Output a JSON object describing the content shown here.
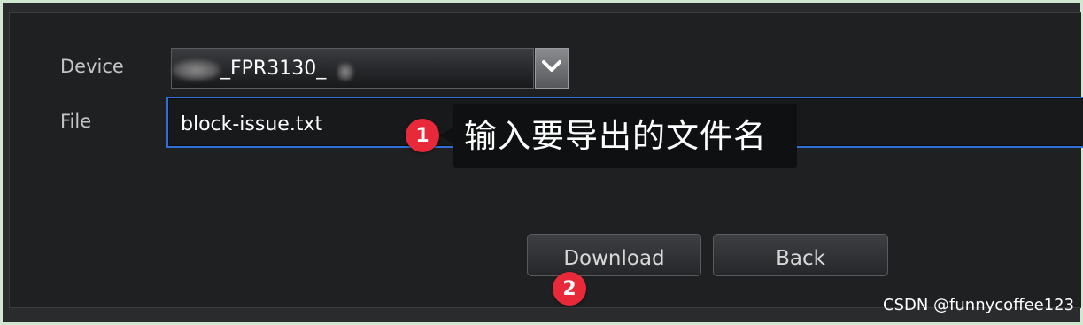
{
  "form": {
    "device_label": "Device",
    "device_value": "_FPR3130_",
    "file_label": "File",
    "file_value": "block-issue.txt"
  },
  "annotation": {
    "tooltip_text": "输入要导出的文件名",
    "marker1": "1",
    "marker2": "2",
    "marker_color": "#e8293a"
  },
  "buttons": {
    "download_label": "Download",
    "back_label": "Back"
  },
  "watermark": "CSDN @funnycoffee123",
  "colors": {
    "focus_border": "#2f6fd6",
    "panel_bg": "#1f2022"
  }
}
